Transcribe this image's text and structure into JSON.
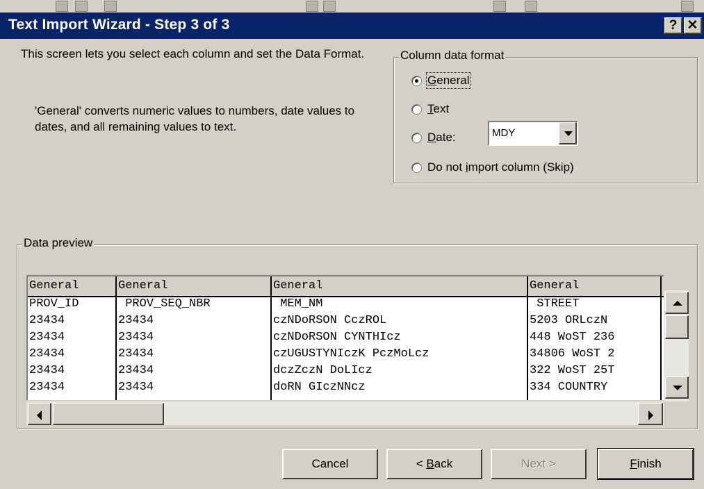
{
  "window": {
    "title": "Text Import Wizard - Step 3 of 3",
    "help_button": "?",
    "close_button": "✕"
  },
  "description": {
    "line1": "This screen lets you select each column and set the Data Format.",
    "line2": "'General' converts numeric values to numbers, date values to dates, and all remaining values to text."
  },
  "column_format": {
    "legend": "Column data format",
    "options": [
      {
        "label_pre": "",
        "label_ul": "G",
        "label_post": "eneral",
        "checked": true
      },
      {
        "label_pre": "",
        "label_ul": "T",
        "label_post": "ext",
        "checked": false
      },
      {
        "label_pre": "",
        "label_ul": "D",
        "label_post": "ate:",
        "checked": false
      },
      {
        "label_pre": "Do not ",
        "label_ul": "i",
        "label_post": "mport column (Skip)",
        "checked": false
      }
    ],
    "date_format": "MDY"
  },
  "preview": {
    "legend": "Data preview",
    "columns": [
      {
        "header": "General",
        "cells": [
          "PROV_ID",
          "23434",
          "23434",
          "23434",
          "23434",
          "23434"
        ]
      },
      {
        "header": "General",
        "cells": [
          " PROV_SEQ_NBR",
          "23434",
          "23434",
          "23434",
          "23434",
          "23434"
        ]
      },
      {
        "header": "General",
        "cells": [
          " MEM_NM",
          "czNDoRSON CczROL",
          "czNDoRSON CYNTHIcz",
          "czUGUSTYNIczK PczMoLcz",
          "dczZczN DoLIcz",
          "doRN GIczNNcz"
        ]
      },
      {
        "header": "General",
        "cells": [
          " STREET",
          "5203 ORLczN",
          "448 WoST 236",
          "34806 WoST 2",
          "322 WoST 25T",
          "334 COUNTRY"
        ]
      }
    ]
  },
  "buttons": {
    "cancel": "Cancel",
    "back_pre": "< ",
    "back_ul": "B",
    "back_post": "ack",
    "next": "Next >",
    "finish_ul": "F",
    "finish_post": "inish"
  }
}
